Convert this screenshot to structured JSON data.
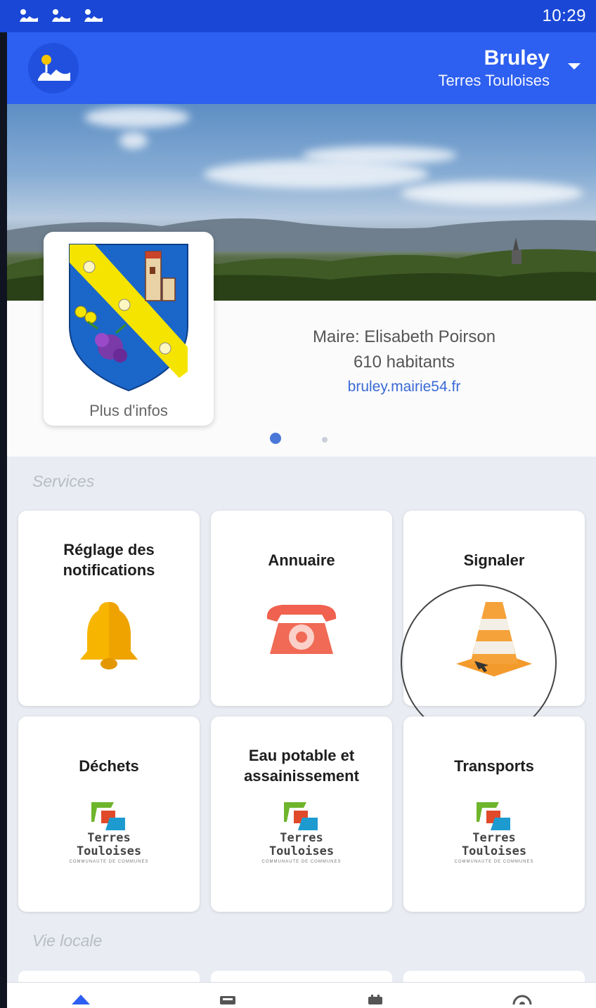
{
  "status_bar": {
    "time": "10:29",
    "icons": [
      "app-notification-icon",
      "app-notification-icon",
      "app-notification-icon"
    ]
  },
  "header": {
    "city": "Bruley",
    "community": "Terres Touloises",
    "logo_icon": "app-logo-icon",
    "dropdown_icon": "caret-down-icon"
  },
  "info": {
    "more_info": "Plus d'infos",
    "mayor": "Maire: Elisabeth Poirson",
    "population": "610 habitants",
    "website": "bruley.mairie54.fr",
    "slide_count": 2,
    "active_slide": 1
  },
  "sections": {
    "services": "Services",
    "local_life": "Vie locale"
  },
  "services": [
    {
      "label": "Réglage des notifications",
      "icon": "bell-icon"
    },
    {
      "label": "Annuaire",
      "icon": "phone-icon"
    },
    {
      "label": "Signaler",
      "icon": "traffic-cone-icon"
    },
    {
      "label": "Déchets",
      "icon": "terres-touloises-logo"
    },
    {
      "label": "Eau potable et assainissement",
      "icon": "terres-touloises-logo"
    },
    {
      "label": "Transports",
      "icon": "terres-touloises-logo"
    }
  ],
  "logo_text": {
    "line1": "Terres",
    "line2": "Touloises",
    "line3": "COMMUNAUTE DE COMMUNES"
  },
  "colors": {
    "primary": "#2d5ff0",
    "status_bar": "#1a47d6",
    "link": "#3a6ad6",
    "bell": "#f5b800",
    "phone": "#f06a55",
    "cone": "#f39a2c"
  }
}
